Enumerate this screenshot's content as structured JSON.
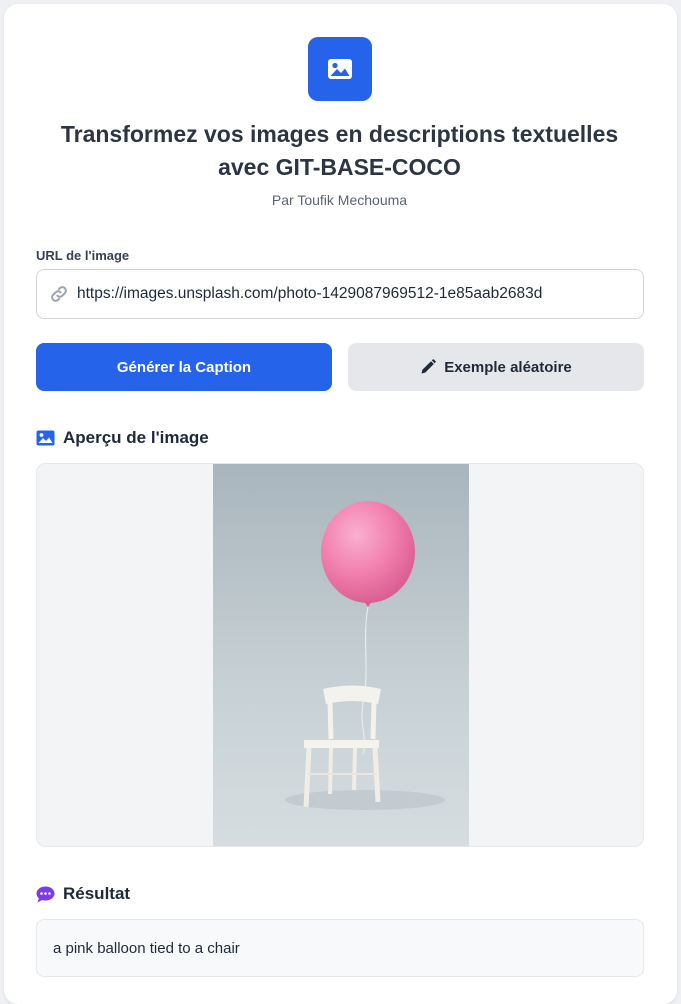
{
  "header": {
    "logo_icon": "image-icon",
    "title_line1": "Transformez vos images en descriptions textuelles",
    "title_line2": "avec GIT-BASE-COCO",
    "subtitle": "Par Toufik Mechouma"
  },
  "form": {
    "url_label": "URL de l'image",
    "url_value": "https://images.unsplash.com/photo-1429087969512-1e85aab2683d",
    "url_icon": "link-icon",
    "generate_label": "Générer la Caption",
    "random_label": "Exemple aléatoire",
    "random_icon": "pencil-icon"
  },
  "preview": {
    "heading": "Aperçu de l'image",
    "icon": "image-icon"
  },
  "result": {
    "heading": "Résultat",
    "icon": "chat-bubble-icon",
    "caption": "a pink balloon tied to a chair"
  },
  "colors": {
    "accent": "#2563eb",
    "result_icon": "#7c3aed",
    "balloon": "#f27fae"
  }
}
